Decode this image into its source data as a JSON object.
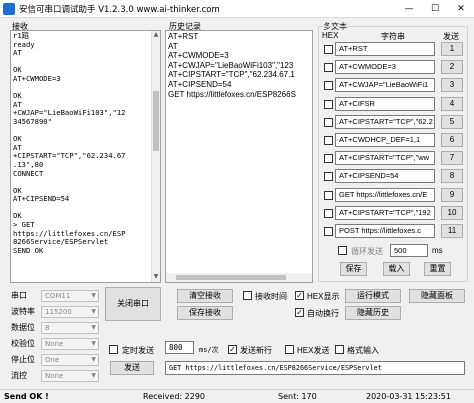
{
  "window": {
    "title": "安信可串口调试助手 V1.2.3.0    www.ai-thinker.com",
    "minimize": "—",
    "maximize": "☐",
    "close": "✕"
  },
  "receive": {
    "label": "接收",
    "lines": [
      "r1蹈",
      "ready",
      "AT",
      "",
      "OK",
      "AT+CWMODE=3",
      "",
      "OK",
      "AT",
      "+CWJAP=\"LieBaoWiFi103\",\"12",
      "34567890\"",
      "",
      "OK",
      "AT",
      "+CIPSTART=\"TCP\",\"62.234.67",
      ".13\",80",
      "CONNECT",
      "",
      "OK",
      "AT+CIPSEND=54",
      "",
      "OK",
      "> GET",
      "https://littlefoxes.cn/ESP",
      "8266Service/ESPServlet",
      "SEND OK"
    ]
  },
  "history": {
    "label": "历史记录",
    "lines": [
      "AT+RST",
      "AT",
      "AT+CWMODE=3",
      "AT+CWJAP=\"LieBaoWiFi103\",\"123",
      "AT+CIPSTART=\"TCP\",\"62.234.67.1",
      "AT+CIPSEND=54",
      "GET https://littlefoxes.cn/ESP8266S"
    ]
  },
  "multitext": {
    "label": "多文本",
    "col_hex": "HEX",
    "col_string": "字符串",
    "col_send": "发送",
    "rows": [
      {
        "text": "AT+RST",
        "send": "1"
      },
      {
        "text": "AT+CWMODE=3",
        "send": "2"
      },
      {
        "text": "AT+CWJAP=\"LieBaoWiFi1",
        "send": "3"
      },
      {
        "text": "AT+CIFSR",
        "send": "4"
      },
      {
        "text": "AT+CIPSTART=\"TCP\",\"62.2",
        "send": "5"
      },
      {
        "text": "AT+CWDHCP_DEF=1,1",
        "send": "6"
      },
      {
        "text": "AT+CIPSTART=\"TCP\",\"ww",
        "send": "7"
      },
      {
        "text": "AT+CIPSEND=54",
        "send": "8"
      },
      {
        "text": "GET https://littlefoxes.cn/E",
        "send": "9"
      },
      {
        "text": "AT+CIPSTART=\"TCP\",\"192",
        "send": "10"
      },
      {
        "text": "POST https://littlefoxes.c",
        "send": "11"
      }
    ],
    "loop_label": "循环发送",
    "loop_value": "500",
    "loop_unit": "ms",
    "save": "保存",
    "load": "载入",
    "reset": "重置"
  },
  "port": {
    "port_label": "串口",
    "port_value": "COM11",
    "baud_label": "波特率",
    "baud_value": "115200",
    "data_label": "数据位",
    "data_value": "8",
    "parity_label": "校验位",
    "parity_value": "None",
    "stop_label": "停止位",
    "stop_value": "One",
    "flow_label": "流控",
    "flow_value": "None",
    "close_button": "关闭串口"
  },
  "controls": {
    "clear_receive": "清空接收",
    "save_receive": "保存接收",
    "recv_time": "接收时间",
    "hex_display": "HEX显示",
    "run_mode": "运行模式",
    "hide_panel": "隐藏面板",
    "auto_wrap": "自动换行",
    "hide_history": "隐藏历史",
    "hex_checked": "✓",
    "wrap_checked": "✓"
  },
  "send": {
    "timed_label": "定时发送",
    "timed_value": "800",
    "timed_unit": "ms/次",
    "newline_label": "发送新行",
    "newline_checked": "✓",
    "hex_send": "HEX发送",
    "format_input": "格式输入",
    "send_button": "发送",
    "input_value": "GET https://littlefoxes.cn/ESP8266Service/ESPServlet"
  },
  "status": {
    "state": "Send OK !",
    "received": "Received: 2290",
    "sent": "Sent: 170",
    "time": "2020-03-31 15:23:51"
  }
}
